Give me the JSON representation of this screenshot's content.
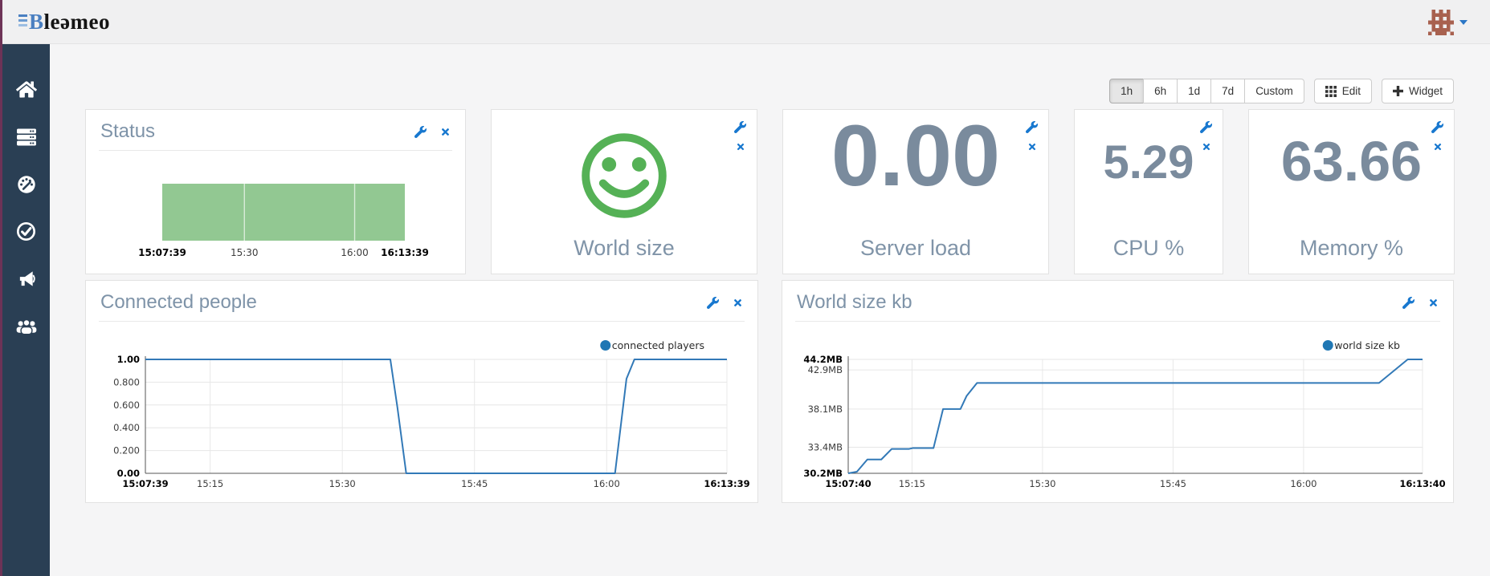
{
  "topbar": {
    "brand_b": "B",
    "brand_rest": "leəmeo"
  },
  "sidebar": {
    "items": [
      "home",
      "servers",
      "dashboards",
      "checks",
      "announcements",
      "users"
    ]
  },
  "toolbar": {
    "ranges": [
      "1h",
      "6h",
      "1d",
      "7d",
      "Custom"
    ],
    "active_range": "1h",
    "edit_label": "Edit",
    "widget_label": "Widget"
  },
  "widgets": {
    "status": {
      "title": "Status"
    },
    "world_size": {
      "label": "World size"
    },
    "server_load": {
      "value": "0.00",
      "label": "Server load"
    },
    "cpu": {
      "value": "5.29",
      "label": "CPU %"
    },
    "memory": {
      "value": "63.66",
      "label": "Memory %"
    },
    "connected_people": {
      "title": "Connected people"
    },
    "world_size_kb": {
      "title": "World size kb"
    }
  },
  "colors": {
    "accent_blue": "#1878cf",
    "chart_line": "#3279b7",
    "legend_dot": "#1f77b4",
    "smiley_green": "#55b156",
    "status_bar_green": "#92c892",
    "value_gray": "#7a8b9d",
    "title_gray": "#7e93a8",
    "sidebar_bg": "#2a3f54",
    "edge_strip": "#6d3357"
  },
  "chart_data": [
    {
      "id": "status",
      "type": "bar",
      "title": "Status",
      "color": "#92c892",
      "x_range": [
        0,
        66
      ],
      "bar": {
        "start": 0,
        "end": 66,
        "state": "ok"
      },
      "separators": [
        22.35,
        52.35
      ],
      "x_ticks": [
        {
          "t": 0,
          "label": "15:07:39",
          "bold": true
        },
        {
          "t": 22.35,
          "label": "15:30"
        },
        {
          "t": 52.35,
          "label": "16:00"
        },
        {
          "t": 66,
          "label": "16:13:39",
          "bold": true
        }
      ]
    },
    {
      "id": "connected_people",
      "type": "line",
      "title": "Connected people",
      "legend": "connected players",
      "color": "#3279b7",
      "dot_color": "#1f77b4",
      "x_range": [
        0,
        66
      ],
      "ylim": [
        0,
        1
      ],
      "y_ticks": [
        {
          "v": 0,
          "label": "0.00",
          "bold": true
        },
        {
          "v": 0.2,
          "label": "0.200"
        },
        {
          "v": 0.4,
          "label": "0.400"
        },
        {
          "v": 0.6,
          "label": "0.600"
        },
        {
          "v": 0.8,
          "label": "0.800"
        },
        {
          "v": 1,
          "label": "1.00",
          "bold": true
        }
      ],
      "x_ticks": [
        {
          "t": 0,
          "label": "15:07:39",
          "bold": true
        },
        {
          "t": 7.35,
          "label": "15:15"
        },
        {
          "t": 22.35,
          "label": "15:30"
        },
        {
          "t": 37.35,
          "label": "15:45"
        },
        {
          "t": 52.35,
          "label": "16:00"
        },
        {
          "t": 66,
          "label": "16:13:39",
          "bold": true
        }
      ],
      "points": [
        [
          0,
          1
        ],
        [
          27.8,
          1
        ],
        [
          28.6,
          0.58
        ],
        [
          29.6,
          0
        ],
        [
          53.3,
          0
        ],
        [
          54.6,
          0.83
        ],
        [
          55.5,
          1
        ],
        [
          66,
          1
        ]
      ]
    },
    {
      "id": "world_size_kb",
      "type": "line",
      "title": "World size kb",
      "legend": "world size kb",
      "color": "#3279b7",
      "dot_color": "#1f77b4",
      "x_range": [
        0,
        66
      ],
      "ylim": [
        30.2,
        44.2
      ],
      "y_ticks": [
        {
          "v": 30.2,
          "label": "30.2MB",
          "bold": true
        },
        {
          "v": 33.4,
          "label": "33.4MB"
        },
        {
          "v": 38.1,
          "label": "38.1MB"
        },
        {
          "v": 42.9,
          "label": "42.9MB"
        },
        {
          "v": 44.2,
          "label": "44.2MB",
          "bold": true
        }
      ],
      "x_ticks": [
        {
          "t": 0,
          "label": "15:07:40",
          "bold": true
        },
        {
          "t": 7.33,
          "label": "15:15"
        },
        {
          "t": 22.33,
          "label": "15:30"
        },
        {
          "t": 37.33,
          "label": "15:45"
        },
        {
          "t": 52.33,
          "label": "16:00"
        },
        {
          "t": 66,
          "label": "16:13:40",
          "bold": true
        }
      ],
      "points": [
        [
          0,
          30.2
        ],
        [
          1,
          30.4
        ],
        [
          2.2,
          31.9
        ],
        [
          3.8,
          31.9
        ],
        [
          5,
          33.2
        ],
        [
          7,
          33.2
        ],
        [
          7.4,
          33.3
        ],
        [
          9.8,
          33.3
        ],
        [
          10.9,
          38.1
        ],
        [
          12.9,
          38.1
        ],
        [
          13.6,
          39.7
        ],
        [
          14.8,
          41.3
        ],
        [
          61,
          41.3
        ],
        [
          64.3,
          44.2
        ],
        [
          66,
          44.2
        ]
      ]
    }
  ]
}
